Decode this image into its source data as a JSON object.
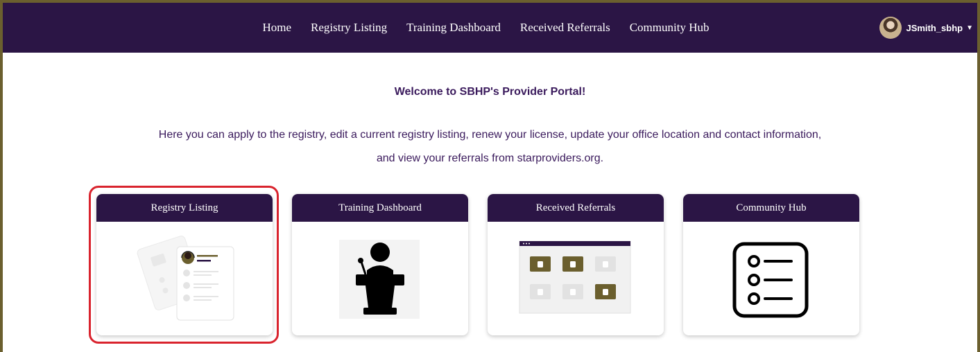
{
  "nav": {
    "links": [
      "Home",
      "Registry Listing",
      "Training Dashboard",
      "Received Referrals",
      "Community Hub"
    ],
    "user": "JSmith_sbhp"
  },
  "welcome": "Welcome to SBHP's Provider Portal!",
  "intro": {
    "line1": "Here you can apply to the registry, edit a current registry listing, renew your license, update your office location and contact information,",
    "line2": "and view your referrals from starproviders.org."
  },
  "cards": [
    {
      "title": "Registry Listing",
      "icon": "registry-listing-illustration",
      "highlighted": true
    },
    {
      "title": "Training Dashboard",
      "icon": "podium-speaker-icon"
    },
    {
      "title": "Received Referrals",
      "icon": "video-grid-illustration"
    },
    {
      "title": "Community Hub",
      "icon": "checklist-icon"
    }
  ],
  "colors": {
    "nav_bg": "#2b1545",
    "accent_gold": "#6b5f2e",
    "highlight_red": "#d9232d",
    "text_purple": "#3a1a5c"
  }
}
